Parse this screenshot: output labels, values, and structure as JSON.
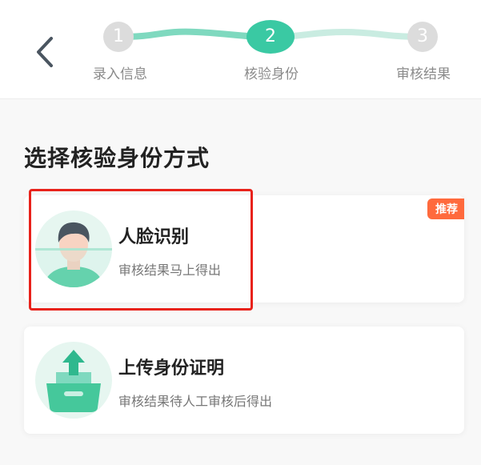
{
  "header": {
    "steps": [
      {
        "number": "1",
        "label": "录入信息",
        "state": "done"
      },
      {
        "number": "2",
        "label": "核验身份",
        "state": "active"
      },
      {
        "number": "3",
        "label": "审核结果",
        "state": "pending"
      }
    ]
  },
  "main": {
    "title": "选择核验身份方式",
    "options": [
      {
        "title": "人脸识别",
        "subtitle": "审核结果马上得出",
        "badge": "推荐",
        "icon": "face-avatar-icon"
      },
      {
        "title": "上传身份证明",
        "subtitle": "审核结果待人工审核后得出",
        "icon": "upload-folder-icon"
      }
    ]
  },
  "colors": {
    "accent": "#3ac9a3",
    "badge": "#ff6a3d",
    "highlight": "#e8221b"
  }
}
